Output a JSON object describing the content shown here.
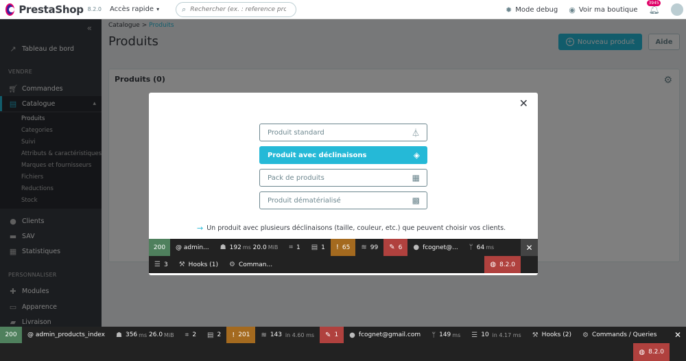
{
  "header": {
    "logo": "PrestaShop",
    "version": "8.2.0",
    "quick_access": "Accès rapide",
    "search_placeholder": "Rechercher (ex. : reference produit, no",
    "debug_mode": "Mode debug",
    "view_shop": "Voir ma boutique",
    "notif_count": "3945"
  },
  "sidebar": {
    "dashboard": "Tableau de bord",
    "section_sell": "VENDRE",
    "orders": "Commandes",
    "catalog": "Catalogue",
    "catalog_sub": [
      "Produits",
      "Categories",
      "Suivi",
      "Attributs & caractéristiques",
      "Marques et fournisseurs",
      "Fichiers",
      "Reductions",
      "Stock"
    ],
    "customers": "Clients",
    "support": "SAV",
    "stats": "Statistiques",
    "section_customize": "PERSONNALISER",
    "modules": "Modules",
    "appearance": "Apparence",
    "shipping": "Livraison"
  },
  "main": {
    "breadcrumb_parent": "Catalogue",
    "breadcrumb_current": "Produits",
    "title": "Produits",
    "new_product": "Nouveau produit",
    "help": "Aide",
    "card_title": "Produits (0)"
  },
  "modal": {
    "options": [
      {
        "label": "Produit standard",
        "icon": "hanger-icon"
      },
      {
        "label": "Produit avec déclinaisons",
        "icon": "layers-icon"
      },
      {
        "label": "Pack de produits",
        "icon": "grid-icon"
      },
      {
        "label": "Produit dématérialisé",
        "icon": "qr-icon"
      }
    ],
    "selected_index": 1,
    "hint": "Un produit avec plusieurs déclinaisons (taille, couleur, etc.) que peuvent choisir vos clients."
  },
  "modal_toolbar": {
    "status": "200",
    "route": "@ admin...",
    "time": "192",
    "time_unit": "ms",
    "memory": "20.0",
    "memory_unit": "MiB",
    "forms": "1",
    "logs": "1",
    "warnings": "65",
    "cache": "99",
    "translations": "6",
    "user": "fcognet@...",
    "twig_time": "64",
    "twig_unit": "ms",
    "db": "3",
    "hooks": "Hooks (1)",
    "commands": "Comman...",
    "sf_version": "8.2.0"
  },
  "bottom_toolbar": {
    "status": "200",
    "route": "@ admin_products_index",
    "time": "356",
    "time_unit": "ms",
    "memory": "26.0",
    "memory_unit": "MiB",
    "forms": "2",
    "logs": "2",
    "warnings": "201",
    "cache": "143",
    "cache_in": "in 4.60 ms",
    "translations": "1",
    "user": "fcognet@gmail.com",
    "twig_time": "149",
    "twig_unit": "ms",
    "db": "10",
    "db_in": "in 4.17 ms",
    "hooks": "Hooks (2)",
    "commands": "Commands / Queries",
    "sf_version": "8.2.0"
  }
}
